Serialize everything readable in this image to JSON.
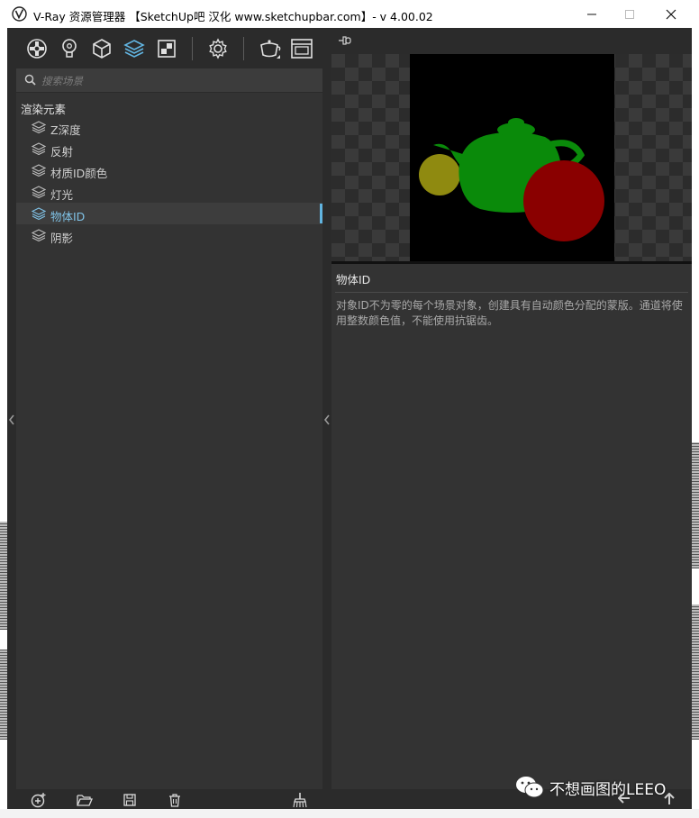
{
  "window": {
    "title": "V-Ray 资源管理器 【SketchUp吧 汉化 www.sketchupbar.com】- v 4.00.02",
    "controls": [
      "minimize-icon",
      "maximize-icon",
      "close-icon"
    ]
  },
  "toolbar": {
    "icons": [
      "materials-icon",
      "lights-icon",
      "geometry-icon",
      "render-elements-icon",
      "textures-icon",
      "settings-icon",
      "render-icon",
      "frame-buffer-icon"
    ],
    "active": "render-elements-icon"
  },
  "search": {
    "placeholder": "搜索场景"
  },
  "tree": {
    "section": "渲染元素",
    "items": [
      {
        "label": "Z深度"
      },
      {
        "label": "反射"
      },
      {
        "label": "材质ID颜色"
      },
      {
        "label": "灯光"
      },
      {
        "label": "物体ID"
      },
      {
        "label": "阴影"
      }
    ],
    "selected_index": 4
  },
  "detail": {
    "name": "物体ID",
    "description": "对象ID不为零的每个场景对象，创建具有自动颜色分配的蒙版。通道将使用整数颜色值，不能使用抗锯齿。"
  },
  "bottom_toolbar": {
    "icons": [
      "add-icon",
      "open-folder-icon",
      "save-icon",
      "delete-icon",
      "purge-icon"
    ]
  },
  "watermark": {
    "text": "不想画图的LEEO"
  },
  "colors": {
    "accent": "#61b4e0",
    "panel": "#333333",
    "frame": "#2b2b2b",
    "teapot": "#0a8a0a",
    "sphere_small": "#8f8a10",
    "sphere_large": "#8a0000"
  }
}
